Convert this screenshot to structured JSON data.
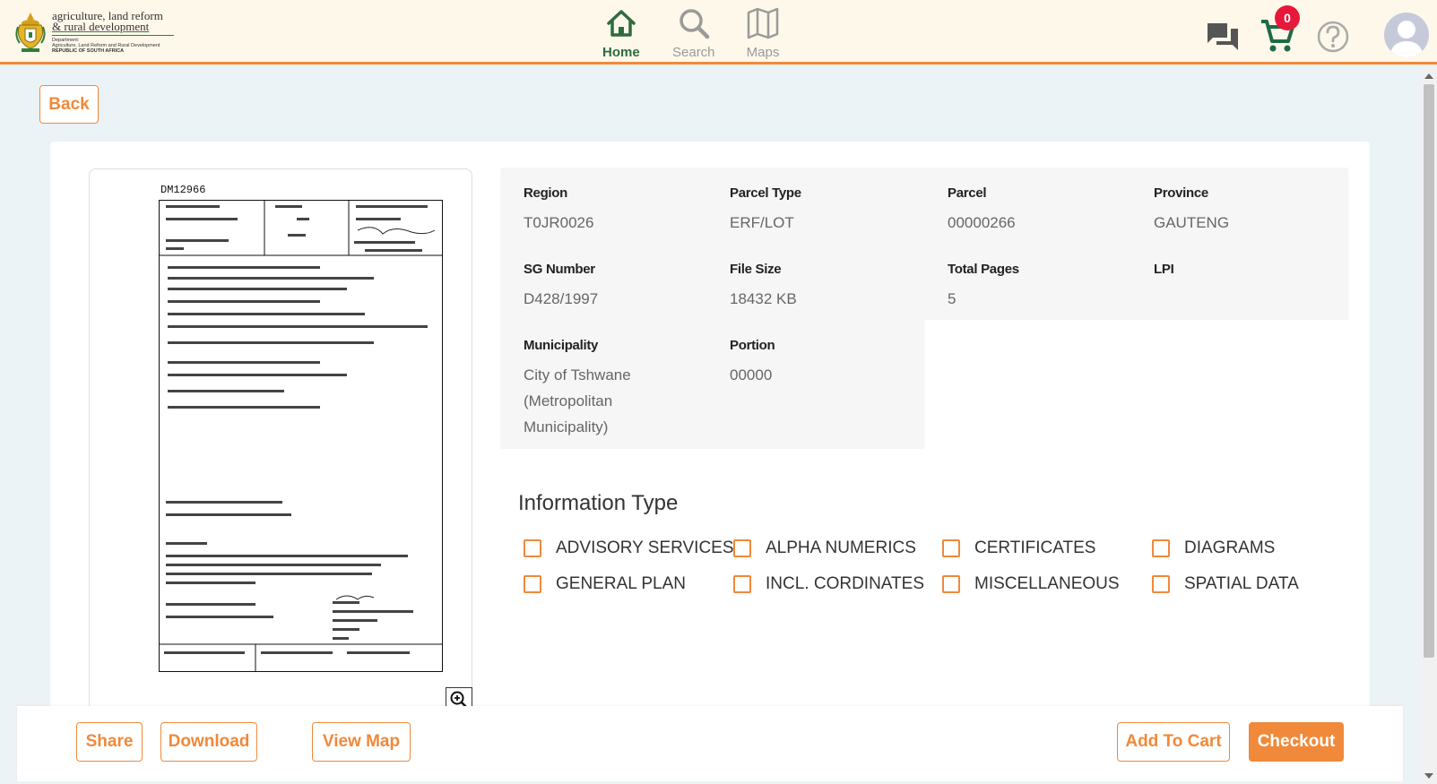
{
  "header": {
    "logo": {
      "line1": "agriculture, land reform",
      "line2": "& rural development",
      "sub1": "Department:",
      "sub2": "Agriculture, Land Reform and Rural Development",
      "sub3": "REPUBLIC OF SOUTH AFRICA"
    },
    "nav": [
      {
        "label": "Home",
        "icon": "home-icon",
        "active": true
      },
      {
        "label": "Search",
        "icon": "search-icon",
        "active": false
      },
      {
        "label": "Maps",
        "icon": "map-icon",
        "active": false
      }
    ],
    "cart_count": "0",
    "colors": {
      "accent": "#f0893a",
      "nav_active": "#2e6b3e",
      "badge": "#e8183a"
    }
  },
  "back_label": "Back",
  "document": {
    "id": "DM12966"
  },
  "details": {
    "region": {
      "label": "Region",
      "value": "T0JR0026"
    },
    "parcel_type": {
      "label": "Parcel Type",
      "value": "ERF/LOT"
    },
    "parcel": {
      "label": "Parcel",
      "value": "00000266"
    },
    "province": {
      "label": "Province",
      "value": "GAUTENG"
    },
    "sg_number": {
      "label": "SG Number",
      "value": "D428/1997"
    },
    "file_size": {
      "label": "File Size",
      "value": "18432 KB"
    },
    "total_pages": {
      "label": "Total Pages",
      "value": "5"
    },
    "lpi": {
      "label": "LPI",
      "value": ""
    },
    "municipality": {
      "label": "Municipality",
      "value": "City of Tshwane (Metropolitan Municipality)"
    },
    "portion": {
      "label": "Portion",
      "value": "00000"
    }
  },
  "info_type": {
    "title": "Information Type",
    "options": [
      {
        "label": "ADVISORY SERVICES",
        "checked": false
      },
      {
        "label": "ALPHA NUMERICS",
        "checked": false
      },
      {
        "label": "CERTIFICATES",
        "checked": false
      },
      {
        "label": "DIAGRAMS",
        "checked": false
      },
      {
        "label": "GENERAL PLAN",
        "checked": false
      },
      {
        "label": "INCL. CORDINATES",
        "checked": false
      },
      {
        "label": "MISCELLANEOUS",
        "checked": false
      },
      {
        "label": "SPATIAL DATA",
        "checked": false
      }
    ]
  },
  "actions": {
    "share": "Share",
    "download": "Download",
    "view_map": "View Map",
    "add_to_cart": "Add To Cart",
    "checkout": "Checkout"
  }
}
